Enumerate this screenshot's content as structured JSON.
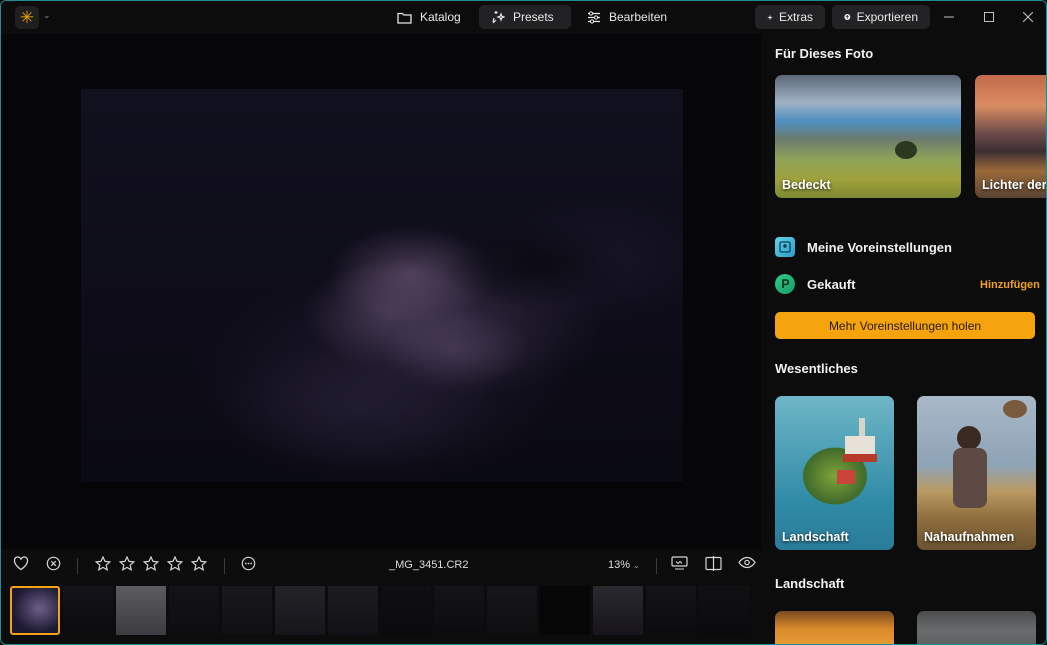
{
  "titlebar": {
    "tabs": [
      {
        "label": "Katalog",
        "icon": "folder-icon",
        "active": false
      },
      {
        "label": "Presets",
        "icon": "sparkle-icon",
        "active": true
      },
      {
        "label": "Bearbeiten",
        "icon": "sliders-icon",
        "active": false
      }
    ],
    "extras_label": "Extras",
    "export_label": "Exportieren"
  },
  "viewer": {
    "filename": "_MG_3451.CR2",
    "zoom": "13%",
    "rating_stars": 0,
    "filmstrip_count": 14,
    "selected_thumb": 0
  },
  "sidebar": {
    "for_photo_title": "Für Dieses Foto",
    "for_photo_cards": [
      {
        "label": "Bedeckt"
      },
      {
        "label": "Lichter der"
      }
    ],
    "my_presets_label": "Meine Voreinstellungen",
    "purchased_label": "Gekauft",
    "add_label": "Hinzufügen",
    "more_presets_button": "Mehr Voreinstellungen holen",
    "essentials_title": "Wesentliches",
    "essentials_cards": [
      {
        "label": "Landschaft"
      },
      {
        "label": "Nahaufnahmen"
      }
    ],
    "landscape_title": "Landschaft"
  },
  "colors": {
    "accent": "#f5a40e",
    "window_border": "#1e8c92",
    "background": "#0c0c0d"
  }
}
